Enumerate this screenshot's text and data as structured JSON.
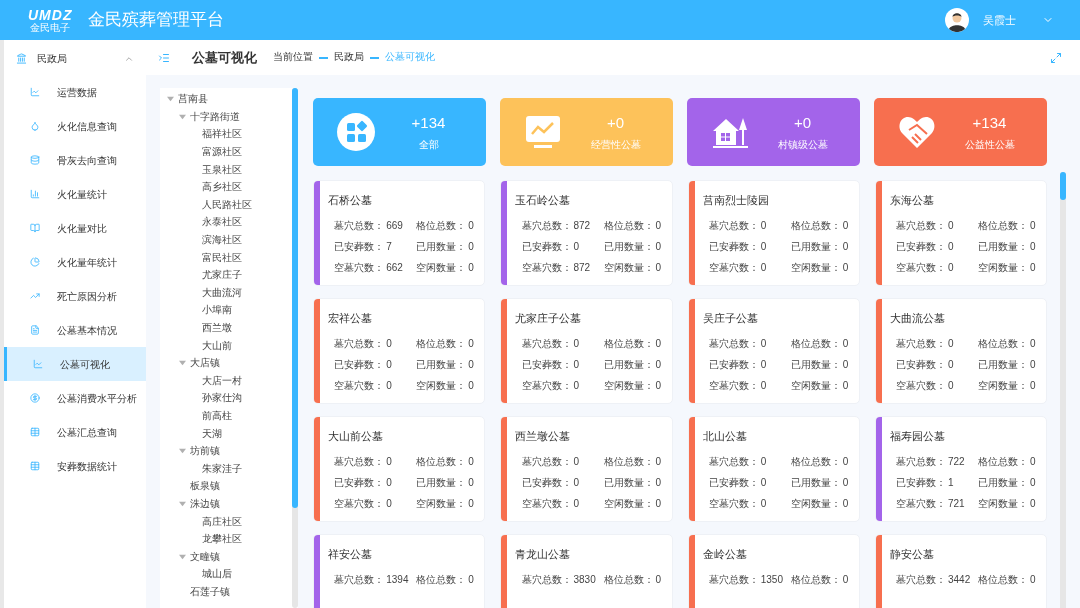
{
  "header": {
    "logo_text": "UMDZ",
    "logo_subtext": "金民电子",
    "title": "金民殡葬管理平台",
    "user": {
      "name": "吴霞士"
    }
  },
  "sidebar": {
    "group": {
      "label": "民政局",
      "expanded": true
    },
    "items": [
      {
        "label": "运营数据",
        "selected": false
      },
      {
        "label": "火化信息查询",
        "selected": false
      },
      {
        "label": "骨灰去向查询",
        "selected": false
      },
      {
        "label": "火化量统计",
        "selected": false
      },
      {
        "label": "火化量对比",
        "selected": false
      },
      {
        "label": "火化量年统计",
        "selected": false
      },
      {
        "label": "死亡原因分析",
        "selected": false
      },
      {
        "label": "公墓基本情况",
        "selected": false
      },
      {
        "label": "公墓可视化",
        "selected": true
      },
      {
        "label": "公墓消费水平分析",
        "selected": false
      },
      {
        "label": "公墓汇总查询",
        "selected": false
      },
      {
        "label": "安葬数据统计",
        "selected": false
      }
    ]
  },
  "page": {
    "title": "公墓可视化",
    "breadcrumb": [
      "当前位置",
      "民政局",
      "公墓可视化"
    ]
  },
  "tree": [
    {
      "label": "莒南县",
      "expanded": true,
      "children": [
        {
          "label": "十字路街道",
          "expanded": true,
          "children": [
            {
              "label": "福祥社区"
            },
            {
              "label": "富源社区"
            },
            {
              "label": "玉泉社区"
            },
            {
              "label": "高乡社区"
            },
            {
              "label": "人民路社区"
            },
            {
              "label": "永泰社区"
            },
            {
              "label": "滨海社区"
            },
            {
              "label": "富民社区"
            },
            {
              "label": "尤家庄子"
            },
            {
              "label": "大曲流河"
            },
            {
              "label": "小埠南"
            },
            {
              "label": "西兰墩"
            },
            {
              "label": "大山前"
            }
          ]
        },
        {
          "label": "大店镇",
          "expanded": true,
          "children": [
            {
              "label": "大店一村"
            },
            {
              "label": "孙家仕沟"
            },
            {
              "label": "前高柱"
            },
            {
              "label": "天湖"
            }
          ]
        },
        {
          "label": "坊前镇",
          "expanded": true,
          "children": [
            {
              "label": "朱家洼子"
            }
          ]
        },
        {
          "label": "板泉镇"
        },
        {
          "label": "洙边镇",
          "expanded": true,
          "children": [
            {
              "label": "高庄社区"
            },
            {
              "label": "龙攀社区"
            }
          ]
        },
        {
          "label": "文疃镇",
          "expanded": true,
          "children": [
            {
              "label": "城山后"
            }
          ]
        },
        {
          "label": "石莲子镇"
        }
      ]
    }
  ],
  "summary": [
    {
      "value": "+134",
      "label": "全部",
      "color": "#38b6ff"
    },
    {
      "value": "+0",
      "label": "经营性公墓",
      "color": "#fdc25a"
    },
    {
      "value": "+0",
      "label": "村镇级公墓",
      "color": "#a364ea"
    },
    {
      "value": "+134",
      "label": "公益性公墓",
      "color": "#f76f4f"
    }
  ],
  "cemeteries": [
    {
      "name": "石桥公墓",
      "color": "#a364ea",
      "stats": [
        [
          "墓穴总数：",
          "669"
        ],
        [
          "格位总数：",
          "0"
        ],
        [
          "已安葬数：",
          "7"
        ],
        [
          "已用数量：",
          "0"
        ],
        [
          "空墓穴数：",
          "662"
        ],
        [
          "空闲数量：",
          "0"
        ]
      ]
    },
    {
      "name": "玉石岭公墓",
      "color": "#a364ea",
      "stats": [
        [
          "墓穴总数：",
          "872"
        ],
        [
          "格位总数：",
          "0"
        ],
        [
          "已安葬数：",
          "0"
        ],
        [
          "已用数量：",
          "0"
        ],
        [
          "空墓穴数：",
          "872"
        ],
        [
          "空闲数量：",
          "0"
        ]
      ]
    },
    {
      "name": "莒南烈士陵园",
      "color": "#f76f4f",
      "stats": [
        [
          "墓穴总数：",
          "0"
        ],
        [
          "格位总数：",
          "0"
        ],
        [
          "已安葬数：",
          "0"
        ],
        [
          "已用数量：",
          "0"
        ],
        [
          "空墓穴数：",
          "0"
        ],
        [
          "空闲数量：",
          "0"
        ]
      ]
    },
    {
      "name": "东海公墓",
      "color": "#f76f4f",
      "stats": [
        [
          "墓穴总数：",
          "0"
        ],
        [
          "格位总数：",
          "0"
        ],
        [
          "已安葬数：",
          "0"
        ],
        [
          "已用数量：",
          "0"
        ],
        [
          "空墓穴数：",
          "0"
        ],
        [
          "空闲数量：",
          "0"
        ]
      ]
    },
    {
      "name": "宏祥公墓",
      "color": "#f76f4f",
      "stats": [
        [
          "墓穴总数：",
          "0"
        ],
        [
          "格位总数：",
          "0"
        ],
        [
          "已安葬数：",
          "0"
        ],
        [
          "已用数量：",
          "0"
        ],
        [
          "空墓穴数：",
          "0"
        ],
        [
          "空闲数量：",
          "0"
        ]
      ]
    },
    {
      "name": "尤家庄子公墓",
      "color": "#f76f4f",
      "stats": [
        [
          "墓穴总数：",
          "0"
        ],
        [
          "格位总数：",
          "0"
        ],
        [
          "已安葬数：",
          "0"
        ],
        [
          "已用数量：",
          "0"
        ],
        [
          "空墓穴数：",
          "0"
        ],
        [
          "空闲数量：",
          "0"
        ]
      ]
    },
    {
      "name": "吴庄子公墓",
      "color": "#f76f4f",
      "stats": [
        [
          "墓穴总数：",
          "0"
        ],
        [
          "格位总数：",
          "0"
        ],
        [
          "已安葬数：",
          "0"
        ],
        [
          "已用数量：",
          "0"
        ],
        [
          "空墓穴数：",
          "0"
        ],
        [
          "空闲数量：",
          "0"
        ]
      ]
    },
    {
      "name": "大曲流公墓",
      "color": "#f76f4f",
      "stats": [
        [
          "墓穴总数：",
          "0"
        ],
        [
          "格位总数：",
          "0"
        ],
        [
          "已安葬数：",
          "0"
        ],
        [
          "已用数量：",
          "0"
        ],
        [
          "空墓穴数：",
          "0"
        ],
        [
          "空闲数量：",
          "0"
        ]
      ]
    },
    {
      "name": "大山前公墓",
      "color": "#f76f4f",
      "stats": [
        [
          "墓穴总数：",
          "0"
        ],
        [
          "格位总数：",
          "0"
        ],
        [
          "已安葬数：",
          "0"
        ],
        [
          "已用数量：",
          "0"
        ],
        [
          "空墓穴数：",
          "0"
        ],
        [
          "空闲数量：",
          "0"
        ]
      ]
    },
    {
      "name": "西兰墩公墓",
      "color": "#f76f4f",
      "stats": [
        [
          "墓穴总数：",
          "0"
        ],
        [
          "格位总数：",
          "0"
        ],
        [
          "已安葬数：",
          "0"
        ],
        [
          "已用数量：",
          "0"
        ],
        [
          "空墓穴数：",
          "0"
        ],
        [
          "空闲数量：",
          "0"
        ]
      ]
    },
    {
      "name": "北山公墓",
      "color": "#f76f4f",
      "stats": [
        [
          "墓穴总数：",
          "0"
        ],
        [
          "格位总数：",
          "0"
        ],
        [
          "已安葬数：",
          "0"
        ],
        [
          "已用数量：",
          "0"
        ],
        [
          "空墓穴数：",
          "0"
        ],
        [
          "空闲数量：",
          "0"
        ]
      ]
    },
    {
      "name": "福寿园公墓",
      "color": "#a364ea",
      "stats": [
        [
          "墓穴总数：",
          "722"
        ],
        [
          "格位总数：",
          "0"
        ],
        [
          "已安葬数：",
          "1"
        ],
        [
          "已用数量：",
          "0"
        ],
        [
          "空墓穴数：",
          "721"
        ],
        [
          "空闲数量：",
          "0"
        ]
      ]
    },
    {
      "name": "祥安公墓",
      "color": "#a364ea",
      "stats": [
        [
          "墓穴总数：",
          "1394"
        ],
        [
          "格位总数：",
          "0"
        ]
      ]
    },
    {
      "name": "青龙山公墓",
      "color": "#f76f4f",
      "stats": [
        [
          "墓穴总数：",
          "3830"
        ],
        [
          "格位总数：",
          "0"
        ]
      ]
    },
    {
      "name": "金岭公墓",
      "color": "#f76f4f",
      "stats": [
        [
          "墓穴总数：",
          "1350"
        ],
        [
          "格位总数：",
          "0"
        ]
      ]
    },
    {
      "name": "静安公墓",
      "color": "#f76f4f",
      "stats": [
        [
          "墓穴总数：",
          "3442"
        ],
        [
          "格位总数：",
          "0"
        ]
      ]
    }
  ]
}
